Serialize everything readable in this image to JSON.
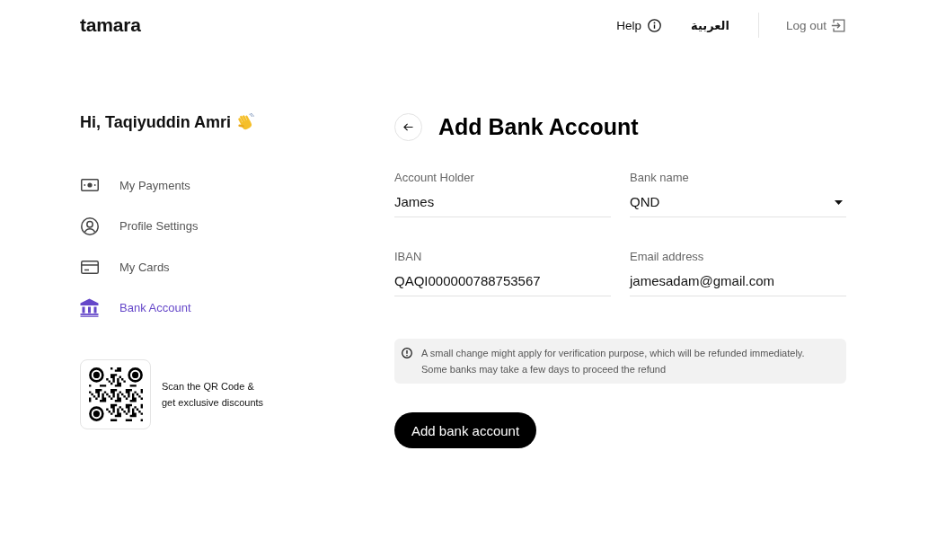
{
  "header": {
    "logo": "tamara",
    "help": "Help",
    "language": "العربية",
    "logout": "Log out"
  },
  "sidebar": {
    "greeting": "Hi, Taqiyuddin Amri",
    "items": [
      {
        "label": "My Payments",
        "selected": false
      },
      {
        "label": "Profile Settings",
        "selected": false
      },
      {
        "label": "My Cards",
        "selected": false
      },
      {
        "label": "Bank Account",
        "selected": true
      }
    ],
    "promo": {
      "lines": [
        "Scan the QR Code &",
        "get exclusive discounts"
      ]
    }
  },
  "main": {
    "title": "Add Bank Account",
    "fields": [
      {
        "label": "Account Holder",
        "value": "James",
        "kind": "text"
      },
      {
        "label": "Bank name",
        "value": "QND",
        "kind": "select"
      },
      {
        "label": "IBAN",
        "value": "QAQI000000788753567",
        "kind": "text"
      },
      {
        "label": "Email address",
        "value": "jamesadam@gmail.com",
        "kind": "text"
      }
    ],
    "notice": {
      "lines": [
        "A small change might apply for verification purpose, which will be refunded immediately.",
        "Some banks may take a few days to proceed the refund"
      ]
    },
    "submit": "Add bank account"
  }
}
